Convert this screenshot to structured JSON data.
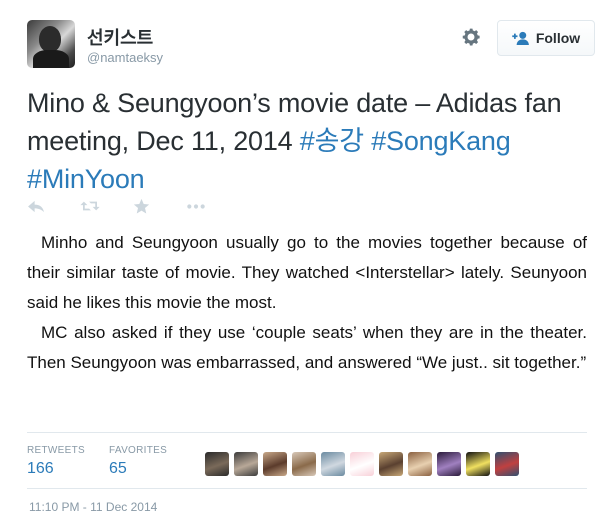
{
  "tweet": {
    "user_name": "선키스트",
    "screen_name": "@namtaeksy",
    "follow_label": "Follow",
    "text": "Mino & Seungyoon’s movie date – Adidas fan meeting, Dec 11, 2014",
    "hashtags": [
      "#송강",
      "#SongKang",
      "#MinYoon"
    ],
    "image_text": [
      "Minho and Seungyoon usually go to the movies together because of their similar taste of movie. They watched <Interstellar> lately. Seunyoon said he likes this movie the most.",
      "MC also asked if they use ‘couple seats’ when they are in the theater. Then Seungyoon was embarrassed, and answered “We just.. sit together.”"
    ],
    "stats": {
      "retweets_label": "RETWEETS",
      "retweets_count": "166",
      "favorites_label": "FAVORITES",
      "favorites_count": "65"
    },
    "timestamp": "11:10 PM - 11 Dec 2014"
  },
  "icons": [
    "gear-icon",
    "follow-person-icon",
    "reply-icon",
    "retweet-icon",
    "favorite-icon",
    "more-icon"
  ],
  "colors": {
    "hashtag": "#2b7bb9",
    "muted": "#8899a6",
    "action_icon": "#ccd6dd",
    "text": "#292f33"
  },
  "favoriter_avatars": [
    [
      "#2a2a2a",
      "#7a6a5a"
    ],
    [
      "#3b3b3b",
      "#b8a898"
    ],
    [
      "#c9a98a",
      "#5b3b2b"
    ],
    [
      "#d8c8b8",
      "#8a6a4a"
    ],
    [
      "#6a8aa0",
      "#d0d8e0"
    ],
    [
      "#f8d0d8",
      "#ffffff"
    ],
    [
      "#c8a878",
      "#5a4030"
    ],
    [
      "#8a6040",
      "#e8d0b0"
    ],
    [
      "#2a1a3a",
      "#a080c0"
    ],
    [
      "#101010",
      "#f0e060"
    ],
    [
      "#305070",
      "#c04040"
    ]
  ]
}
